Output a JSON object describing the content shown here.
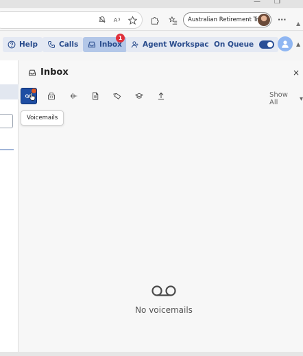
{
  "browser": {
    "profile_name": "Australian Retirement Trust",
    "more_label": "···",
    "icons": [
      "tracking-icon",
      "read-aloud-icon",
      "favorite-star-icon",
      "extensions-icon",
      "favorites-list-icon"
    ]
  },
  "toolbar": {
    "help_label": "Help",
    "calls_label": "Calls",
    "inbox_label": "Inbox",
    "inbox_badge": "1",
    "agent_workspace_label": "Agent Workspace",
    "on_queue_label": "On Queue",
    "on_queue_enabled": true
  },
  "inbox": {
    "title": "Inbox",
    "close_label": "×",
    "show_all_label": "Show All",
    "filter_tabs": [
      {
        "name": "voicemails",
        "icon": "voicemail-icon",
        "selected": true
      },
      {
        "name": "fax",
        "icon": "fax-icon"
      },
      {
        "name": "recordings",
        "icon": "waveform-icon"
      },
      {
        "name": "documents",
        "icon": "document-icon"
      },
      {
        "name": "tags",
        "icon": "tag-icon"
      },
      {
        "name": "training",
        "icon": "graduation-cap-icon"
      },
      {
        "name": "uploads",
        "icon": "upload-icon"
      }
    ],
    "tooltip_label": "Voicemails",
    "empty_message": "No voicemails"
  },
  "colors": {
    "accent": "#284b8c",
    "selected_tab": "#1f4ea3",
    "badge": "#e0303a",
    "notification_dot": "#e05a22"
  }
}
